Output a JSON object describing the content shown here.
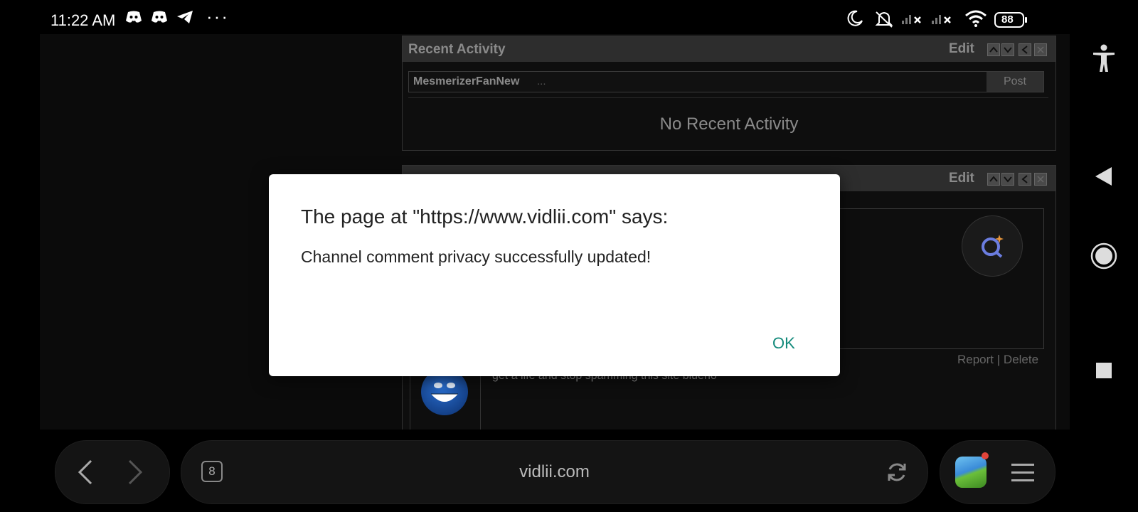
{
  "status_bar": {
    "time": "11:22 AM",
    "battery": "88",
    "icons": [
      "discord-icon",
      "discord-icon",
      "telegram-icon",
      "more-dots-icon",
      "moon-icon",
      "silent-icon",
      "signal-x-icon",
      "signal-x-icon",
      "wifi-icon",
      "battery-icon"
    ],
    "dots": "···"
  },
  "recent_activity": {
    "title": "Recent Activity",
    "edit_label": "Edit",
    "username": "MesmerizerFanNew",
    "input_placeholder": "...",
    "post_label": "Post",
    "empty_text": "No Recent Activity"
  },
  "channel_comments": {
    "edit_label": "Edit",
    "report_label": "Report",
    "delete_label": "Delete",
    "separator": "|",
    "comment_text": "get a life and stop spamming this site blueno"
  },
  "dialog": {
    "title": "The page at \"https://www.vidlii.com\" says:",
    "message": "Channel comment privacy successfully updated!",
    "ok_label": "OK"
  },
  "browser": {
    "url": "vidlii.com",
    "tab_count": "8"
  },
  "colors": {
    "accent_ok": "#138a7b",
    "dialog_bg": "#ffffff",
    "page_bg": "#0b0b0b",
    "panel_head": "#2d2d2d"
  }
}
